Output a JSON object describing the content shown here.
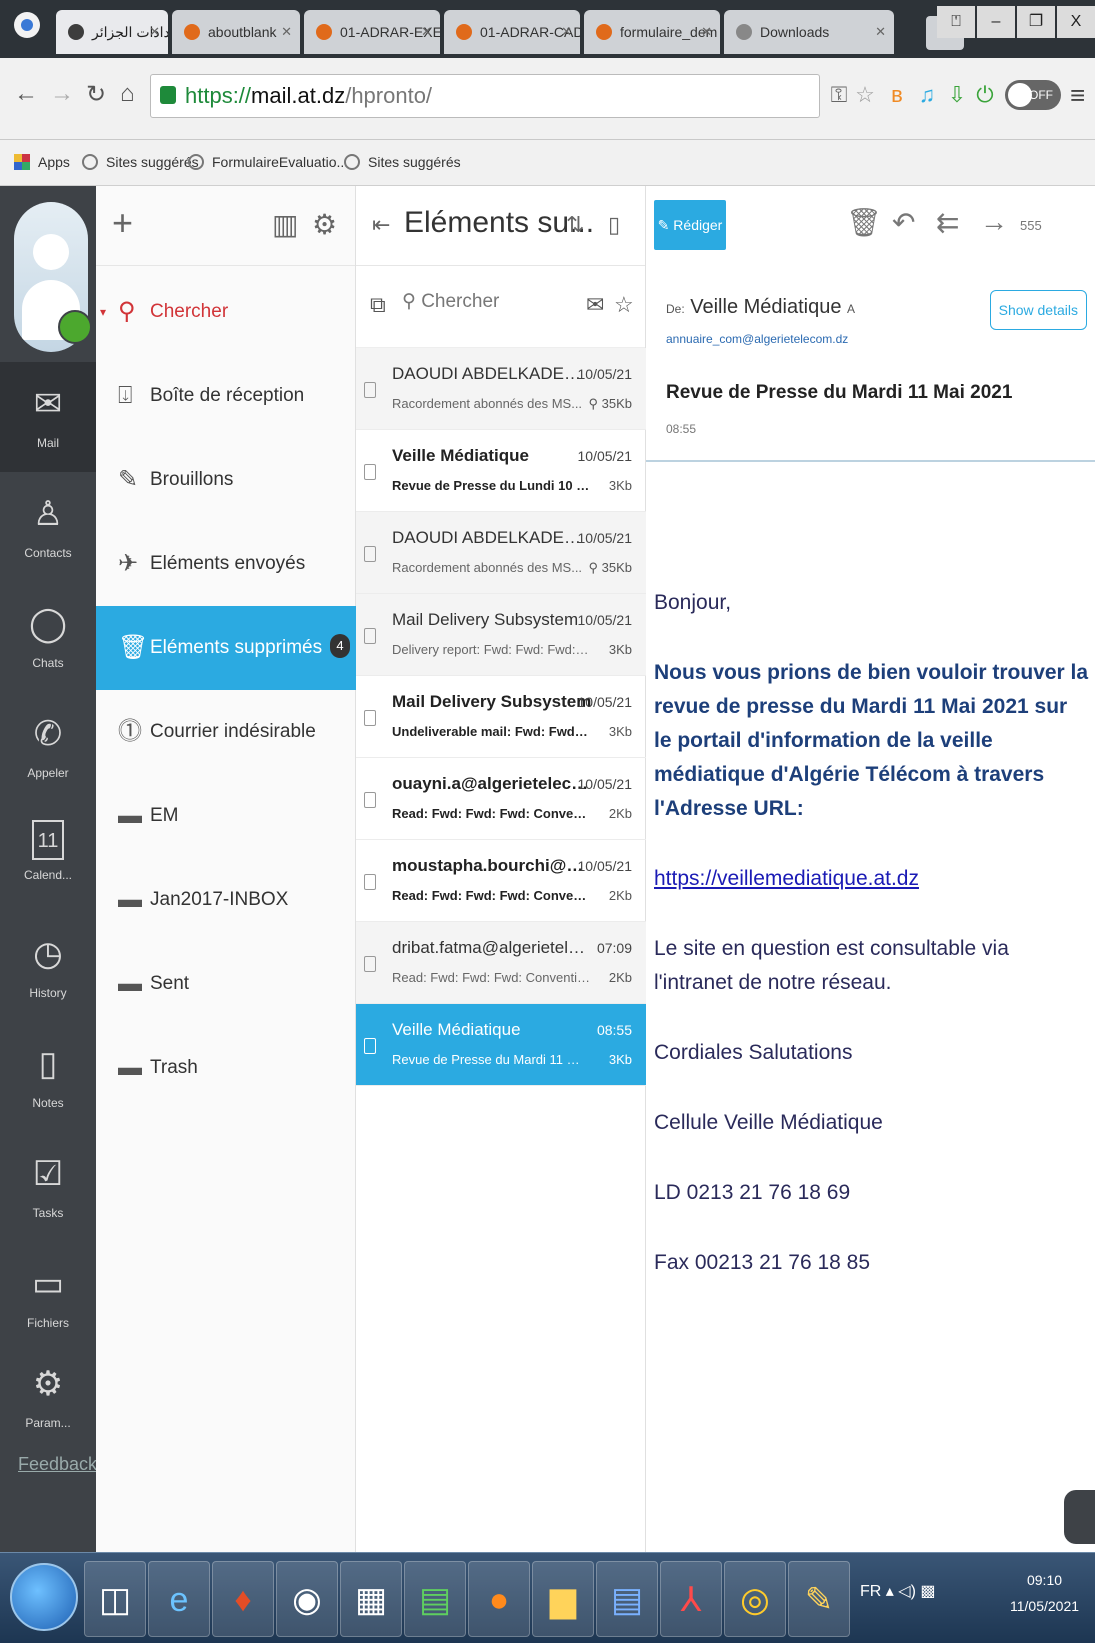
{
  "browser": {
    "tabs": [
      {
        "label": "إعدادات الجزائر",
        "active": true
      },
      {
        "label": "aboutblank",
        "active": false
      },
      {
        "label": "01-ADRAR-EXE",
        "active": false
      },
      {
        "label": "01-ADRAR-CAD",
        "active": false
      },
      {
        "label": "formulaire_dem",
        "active": false
      },
      {
        "label": "Downloads",
        "active": false
      }
    ],
    "url": {
      "scheme": "https://",
      "host": "mail.at.dz",
      "path": "/hpronto/"
    },
    "off_toggle": "OFF",
    "bookmarks": [
      "Apps",
      "Sites suggérés",
      "FormulaireEvaluatio...",
      "Sites suggérés"
    ]
  },
  "rail": {
    "items": [
      {
        "label": "Mail",
        "icon": "mail-icon",
        "active": true
      },
      {
        "label": "Contacts",
        "icon": "contacts-icon"
      },
      {
        "label": "Chats",
        "icon": "chats-icon"
      },
      {
        "label": "Appeler",
        "icon": "phone-icon"
      },
      {
        "label": "Calend...",
        "icon": "calendar-icon",
        "day": "11"
      },
      {
        "label": "History",
        "icon": "history-icon"
      },
      {
        "label": "Notes",
        "icon": "notes-icon"
      },
      {
        "label": "Tasks",
        "icon": "tasks-icon"
      },
      {
        "label": "Fichiers",
        "icon": "files-icon"
      },
      {
        "label": "Param...",
        "icon": "settings-icon"
      }
    ],
    "feedback": "Feedback"
  },
  "folders": {
    "search_label": "Chercher",
    "items": [
      {
        "label": "Boîte de réception",
        "icon": "inbox-icon"
      },
      {
        "label": "Brouillons",
        "icon": "pencil-icon"
      },
      {
        "label": "Eléments envoyés",
        "icon": "sent-icon"
      },
      {
        "label": "Eléments supprimés",
        "icon": "trash-icon",
        "count": "4",
        "active": true
      },
      {
        "label": "Courrier indésirable",
        "icon": "junk-icon"
      },
      {
        "label": "EM",
        "icon": "folder-icon"
      },
      {
        "label": "Jan2017-INBOX",
        "icon": "folder-icon"
      },
      {
        "label": "Sent",
        "icon": "folder-icon"
      },
      {
        "label": "Trash",
        "icon": "folder-icon"
      }
    ]
  },
  "list": {
    "title": "Eléments su...",
    "search_placeholder": "Chercher",
    "messages": [
      {
        "from": "DAOUDI ABDELKADER D...",
        "date": "10/05/21",
        "subject": "Racordement abonnés des MS...",
        "size": "35Kb",
        "attachment": true,
        "state": "read"
      },
      {
        "from": "Veille Médiatique",
        "date": "10/05/21",
        "subject": "Revue de Presse du Lundi 10 Ma ...",
        "size": "3Kb",
        "state": "unread"
      },
      {
        "from": "DAOUDI ABDELKADER D...",
        "date": "10/05/21",
        "subject": "Racordement abonnés des MS...",
        "size": "35Kb",
        "attachment": true,
        "state": "read"
      },
      {
        "from": "Mail Delivery Subsystem",
        "date": "10/05/21",
        "subject": "Delivery report: Fwd: Fwd: Fwd: Con...",
        "size": "3Kb",
        "state": "read"
      },
      {
        "from": "Mail Delivery Subsystem",
        "date": "10/05/21",
        "subject": "Undeliverable mail: Fwd: Fwd: Fw...",
        "size": "3Kb",
        "state": "unread"
      },
      {
        "from": "ouayni.a@algerietelecom...",
        "date": "10/05/21",
        "subject": "Read: Fwd: Fwd: Fwd: Conventio...",
        "size": "2Kb",
        "state": "unread"
      },
      {
        "from": "moustapha.bourchi@alge...",
        "date": "10/05/21",
        "subject": "Read: Fwd: Fwd: Fwd: Conventio...",
        "size": "2Kb",
        "state": "unread"
      },
      {
        "from": "dribat.fatma@algerieteleco...",
        "date": "07:09",
        "subject": "Read: Fwd: Fwd: Fwd: Convention ...",
        "size": "2Kb",
        "state": "read"
      },
      {
        "from": "Veille Médiatique",
        "date": "08:55",
        "subject": "Revue de Presse du Mardi 11 Mai 2...",
        "size": "3Kb",
        "state": "selected"
      }
    ]
  },
  "reader": {
    "compose_label": "Rédiger",
    "more_label": "555",
    "from_prefix": "De:",
    "from_name": "Veille Médiatique",
    "to_prefix": "A",
    "to_address": "annuaire_com@algerietelecom.dz",
    "show_details": "Show details",
    "subject": "Revue de Presse du Mardi 11 Mai 2021",
    "time": "08:55",
    "body": {
      "greeting": "Bonjour,",
      "intro": "Nous vous prions de bien vouloir trouver la revue de presse du Mardi 11 Mai 2021 sur le portail d'information de la veille médiatique d'Algérie Télécom à travers l'Adresse URL:",
      "link": "https://veillemediatique.at.dz",
      "note": "Le site en question est consultable via l'intranet de notre réseau.",
      "closing": "Cordiales Salutations",
      "signature": "Cellule Veille Médiatique",
      "phone": "LD 0213 21 76 18 69",
      "fax": "Fax 00213 21 76 18 85"
    }
  },
  "taskbar": {
    "lang": "FR",
    "time": "09:10",
    "date": "11/05/2021"
  },
  "colors": {
    "accent": "#2baae1",
    "rail": "#3e4247",
    "search_red": "#d13438",
    "presence": "#4ca82e"
  }
}
